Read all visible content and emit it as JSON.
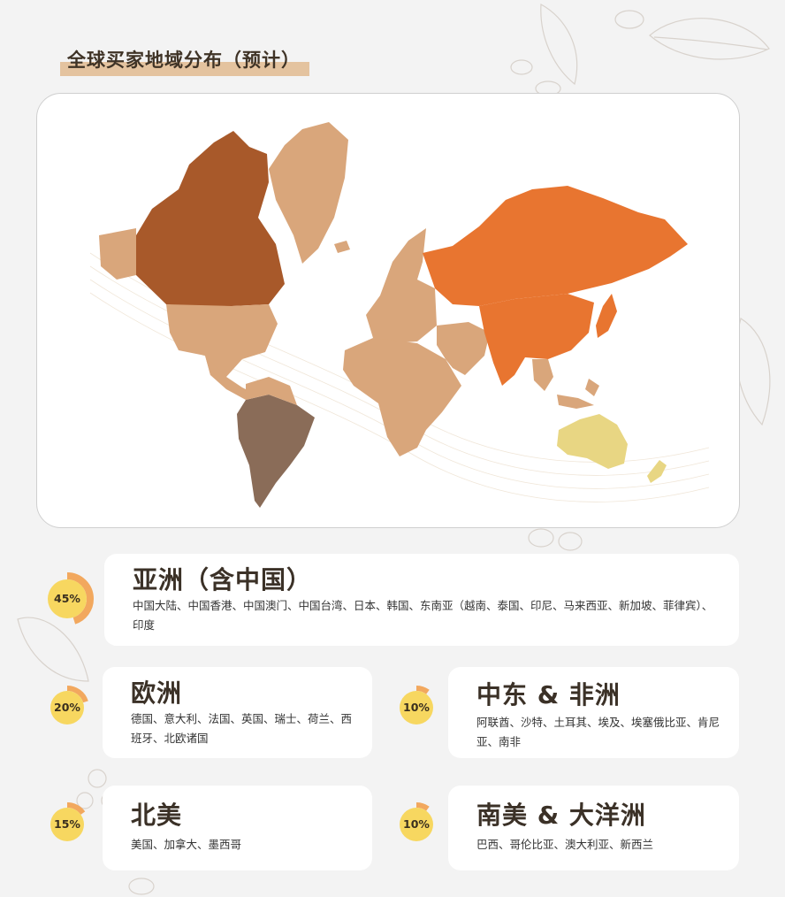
{
  "title": "全球买家地域分布（预计）",
  "colors": {
    "north_america": "#a8592a",
    "russia_asia": "#e87530",
    "south_america": "#8a6c58",
    "oceania": "#e8d683",
    "others": "#d9a67b",
    "badge_fill": "#f7d760",
    "badge_ring": "#f2a85e"
  },
  "regions": [
    {
      "pct": "45%",
      "share": 0.45,
      "name": "亚洲（含中国）",
      "desc": "中国大陆、中国香港、中国澳门、中国台湾、日本、韩国、东南亚（越南、泰国、印尼、马来西亚、新加坡、菲律宾）、印度"
    },
    {
      "pct": "20%",
      "share": 0.2,
      "name": "欧洲",
      "desc": "德国、意大利、法国、英国、瑞士、荷兰、西班牙、北欧诸国"
    },
    {
      "pct": "10%",
      "share": 0.1,
      "name": "中东 & 非洲",
      "desc": "阿联酋、沙特、土耳其、埃及、埃塞俄比亚、肯尼亚、南非"
    },
    {
      "pct": "15%",
      "share": 0.15,
      "name": "北美",
      "desc": "美国、加拿大、墨西哥"
    },
    {
      "pct": "10%",
      "share": 0.1,
      "name": "南美 & 大洋洲",
      "desc": "巴西、哥伦比亚、澳大利亚、新西兰"
    }
  ]
}
